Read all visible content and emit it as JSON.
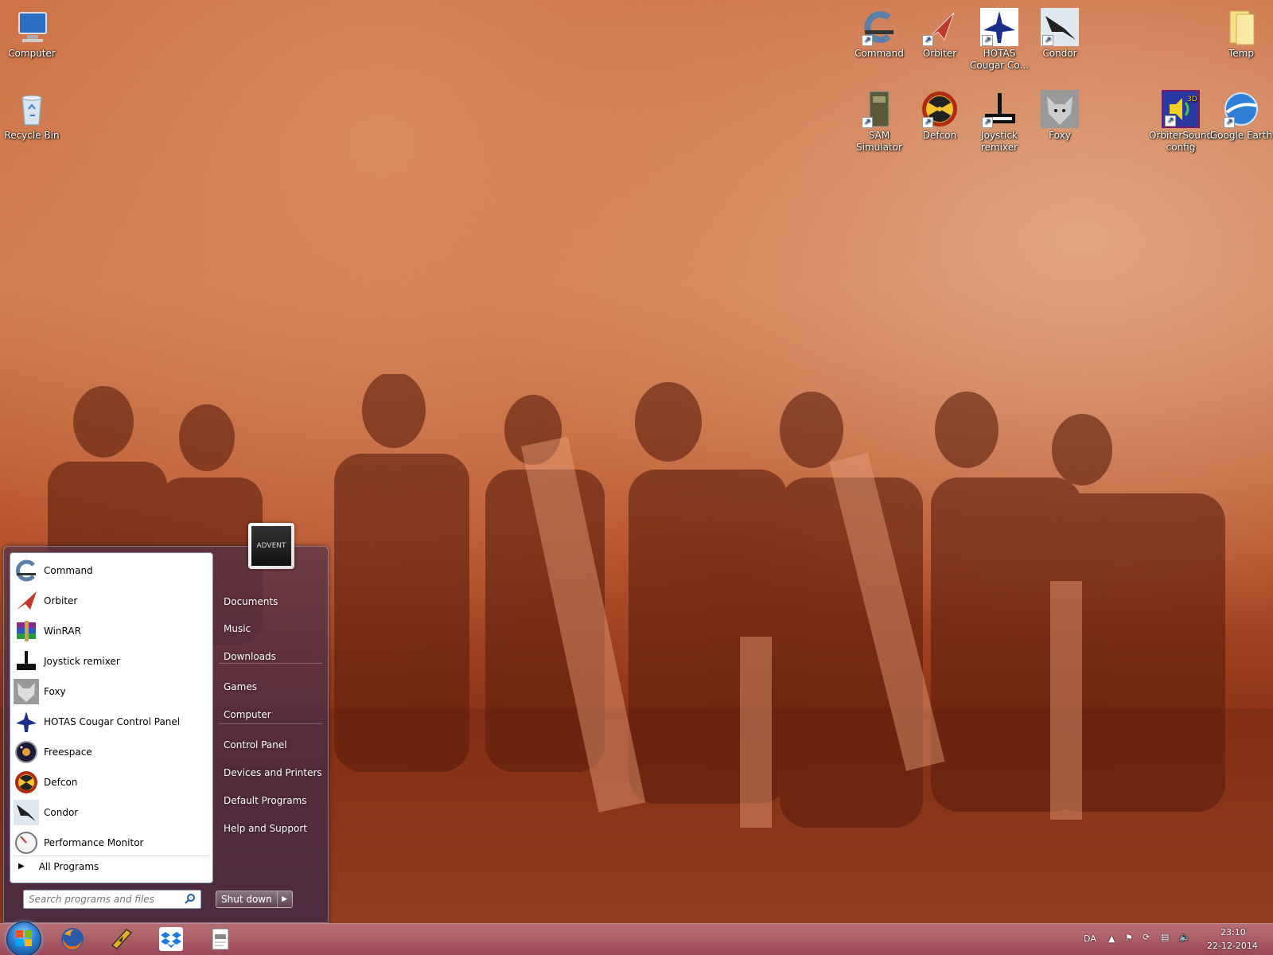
{
  "desktop": {
    "icons_left": [
      {
        "label": "Computer",
        "icon": "computer-icon"
      },
      {
        "label": "Recycle Bin",
        "icon": "recycle-bin-icon"
      }
    ],
    "icons_right_row1": [
      {
        "label": "Command",
        "icon": "command-icon"
      },
      {
        "label": "Orbiter",
        "icon": "orbiter-icon"
      },
      {
        "label": "HOTAS Cougar Co...",
        "icon": "hotas-icon"
      },
      {
        "label": "Condor",
        "icon": "condor-icon"
      }
    ],
    "icon_temp": {
      "label": "Temp",
      "icon": "folder-icon"
    },
    "icons_right_row2": [
      {
        "label": "SAM Simulator",
        "icon": "sam-simulator-icon"
      },
      {
        "label": "Defcon",
        "icon": "defcon-icon"
      },
      {
        "label": "Joystick remixer",
        "icon": "joystick-icon"
      },
      {
        "label": "Foxy",
        "icon": "foxy-icon"
      }
    ],
    "icons_far_right": [
      {
        "label": "OrbiterSound config",
        "icon": "orbitersound-icon"
      },
      {
        "label": "Google Earth",
        "icon": "google-earth-icon"
      }
    ]
  },
  "start_menu": {
    "programs": [
      {
        "label": "Command",
        "icon": "command-icon"
      },
      {
        "label": "Orbiter",
        "icon": "orbiter-icon"
      },
      {
        "label": "WinRAR",
        "icon": "winrar-icon"
      },
      {
        "label": "Joystick remixer",
        "icon": "joystick-icon"
      },
      {
        "label": "Foxy",
        "icon": "foxy-icon"
      },
      {
        "label": "HOTAS Cougar Control Panel",
        "icon": "hotas-icon"
      },
      {
        "label": "Freespace",
        "icon": "freespace-icon"
      },
      {
        "label": "Defcon",
        "icon": "defcon-icon"
      },
      {
        "label": "Condor",
        "icon": "condor-icon"
      },
      {
        "label": "Performance Monitor",
        "icon": "performance-monitor-icon"
      }
    ],
    "all_programs": "All Programs",
    "search_placeholder": "Search programs and files",
    "user_picture_text": "ADVENT",
    "right_links": {
      "documents": "Documents",
      "music": "Music",
      "downloads": "Downloads",
      "games": "Games",
      "computer": "Computer",
      "control_panel": "Control Panel",
      "devices_printers": "Devices and Printers",
      "default_programs": "Default Programs",
      "help_support": "Help and Support"
    },
    "shutdown": "Shut down"
  },
  "taskbar": {
    "pinned": [
      "firefox-icon",
      "winamp-icon",
      "dropbox-icon",
      "document-icon"
    ],
    "language": "DA",
    "time": "23:10",
    "date": "22-12-2014"
  },
  "colors": {
    "wallpaper_tint": "#c9683e",
    "start_orb": "#2f7fd0",
    "taskbar": "#a85a72"
  }
}
